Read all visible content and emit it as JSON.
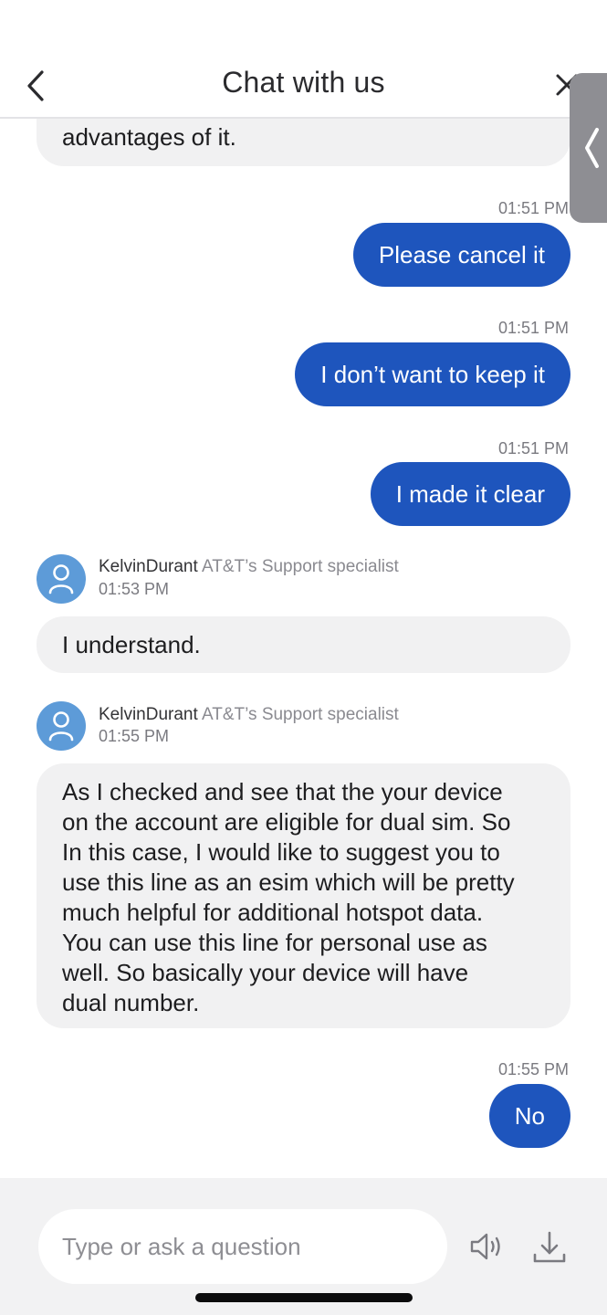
{
  "header": {
    "title": "Chat with us"
  },
  "messages": {
    "agent_prev_tail": "advantages of it.",
    "user1": {
      "time": "01:51 PM",
      "text": "Please cancel it"
    },
    "user2": {
      "time": "01:51 PM",
      "text": "I don’t want to keep it"
    },
    "user3": {
      "time": "01:51 PM",
      "text": "I made it clear"
    },
    "agent1": {
      "name": "KelvinDurant",
      "role": "AT&T’s Support specialist",
      "time": "01:53 PM",
      "text": "I understand."
    },
    "agent2": {
      "name": "KelvinDurant",
      "role": "AT&T’s Support specialist",
      "time": "01:55 PM",
      "lines": [
        "As I checked and see that the your device",
        "on the account are eligible for dual sim. So",
        "In this case, I would like to suggest you to",
        "use this line as an esim which will be pretty",
        "much helpful for additional hotspot data.",
        "You can use this line for personal use as",
        "well. So basically your device will have",
        "dual number."
      ]
    },
    "user4": {
      "time": "01:55 PM",
      "text": "No"
    }
  },
  "composer": {
    "placeholder": "Type or ask a question"
  },
  "icons": {
    "back": "chevron-left-icon",
    "close": "close-icon",
    "side_tab": "chevron-left-icon",
    "avatar": "user-icon",
    "speaker": "speaker-icon",
    "download": "download-icon"
  },
  "colors": {
    "user_bubble": "#1e55bd",
    "agent_bubble": "#f1f1f2",
    "avatar": "#5d9bd8"
  }
}
